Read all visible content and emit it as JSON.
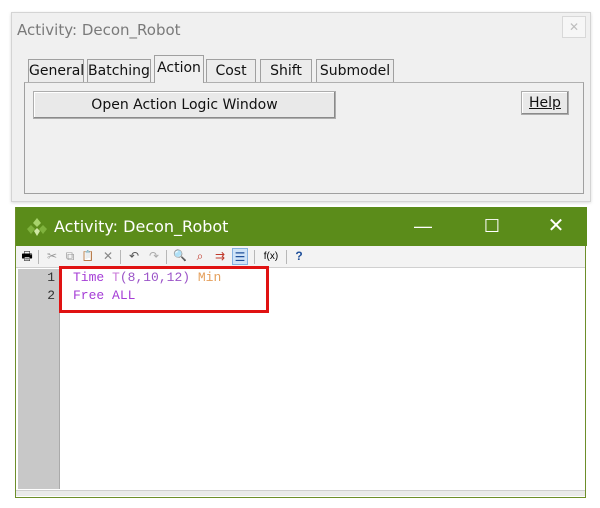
{
  "dialog": {
    "title": "Activity: Decon_Robot",
    "close_glyph": "✕",
    "tabs": [
      {
        "label": "General",
        "active": false
      },
      {
        "label": "Batching",
        "active": false
      },
      {
        "label": "Action",
        "active": true
      },
      {
        "label": "Cost",
        "active": false
      },
      {
        "label": "Shift",
        "active": false
      },
      {
        "label": "Submodel",
        "active": false
      }
    ],
    "open_logic_button": "Open Action Logic Window",
    "help_button": "Help"
  },
  "editor": {
    "title": "Activity: Decon_Robot",
    "title_color": "#5b8c1a",
    "window_controls": {
      "minimize": "—",
      "maximize": "☐",
      "close": "✕"
    },
    "toolbar": [
      {
        "name": "print-icon",
        "glyph": "🖶"
      },
      {
        "name": "cut-icon",
        "glyph": "✂"
      },
      {
        "name": "copy-icon",
        "glyph": "⧉"
      },
      {
        "name": "paste-icon",
        "glyph": "📋"
      },
      {
        "name": "delete-icon",
        "glyph": "✕"
      },
      {
        "name": "undo-icon",
        "glyph": "↶"
      },
      {
        "name": "redo-icon",
        "glyph": "↷"
      },
      {
        "name": "find-icon",
        "glyph": "🔍"
      },
      {
        "name": "find-replace-icon",
        "glyph": "⌕"
      },
      {
        "name": "goto-icon",
        "glyph": "⇉"
      },
      {
        "name": "format-icon",
        "glyph": "☰"
      },
      {
        "name": "function-icon",
        "glyph": "f(x)"
      },
      {
        "name": "help-icon",
        "glyph": "?"
      }
    ],
    "line_numbers": [
      "1",
      "2"
    ],
    "code": {
      "line1": {
        "kw": "Time",
        "fn": "T",
        "args": "(8,10,12)",
        "unit": "Min"
      },
      "line2": {
        "kw": "Free",
        "arg": "ALL"
      }
    },
    "highlight_color": "#e01212"
  }
}
